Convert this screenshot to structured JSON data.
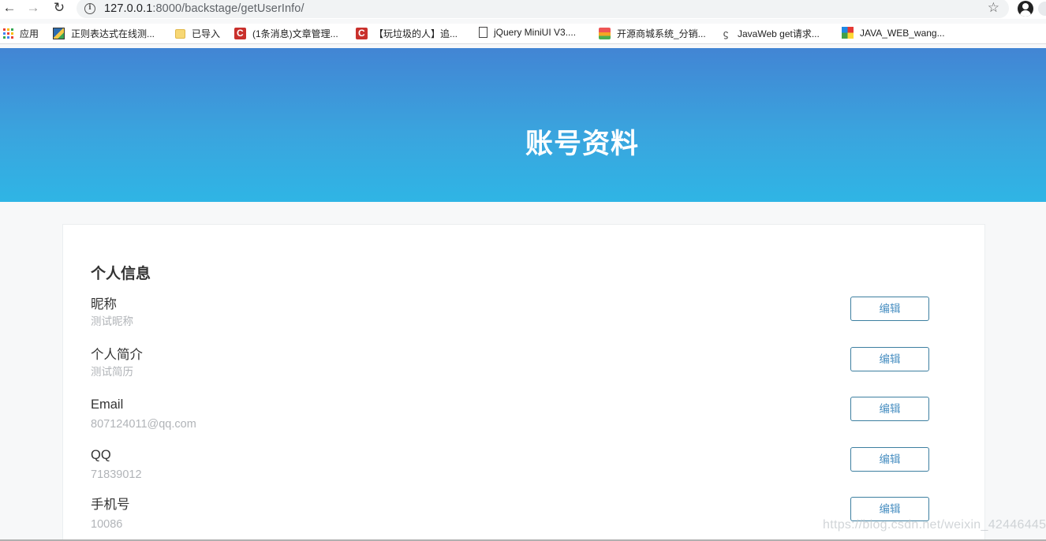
{
  "browser": {
    "url_host": "127.0.0.1",
    "url_path": ":8000/backstage/getUserInfo/",
    "bookmarks": [
      {
        "label": "应用",
        "icon": "apps-grid-icon"
      },
      {
        "label": "正则表达式在线测...",
        "icon": "regex-tool-icon"
      },
      {
        "label": "已导入",
        "icon": "folder-icon"
      },
      {
        "label": "(1条消息)文章管理...",
        "icon": "csdn-icon"
      },
      {
        "label": "【玩垃圾的人】追...",
        "icon": "csdn-icon"
      },
      {
        "label": "jQuery MiniUI V3....",
        "icon": "document-icon"
      },
      {
        "label": "开源商城系统_分销...",
        "icon": "shop-icon"
      },
      {
        "label": "JavaWeb get请求...",
        "icon": "javaweb-icon"
      },
      {
        "label": "JAVA_WEB_wang...",
        "icon": "mosaic-icon"
      }
    ]
  },
  "page": {
    "title": "账号资料",
    "section_title": "个人信息",
    "edit_label": "编辑",
    "fields": [
      {
        "label": "昵称",
        "value": "测试昵称"
      },
      {
        "label": "个人简介",
        "value": "测试简历"
      },
      {
        "label": "Email",
        "value": "807124011@qq.com"
      },
      {
        "label": "QQ",
        "value": "71839012"
      },
      {
        "label": "手机号",
        "value": "10086"
      }
    ]
  },
  "watermark": "https://blog.csdn.net/weixin_42446445",
  "colors": {
    "header_gradient_top": "#4285d4",
    "header_gradient_bottom": "#2fb5e5",
    "edit_button_border": "#3d7fa0",
    "edit_button_text": "#4a90c2",
    "value_text": "#b1b4b8"
  }
}
